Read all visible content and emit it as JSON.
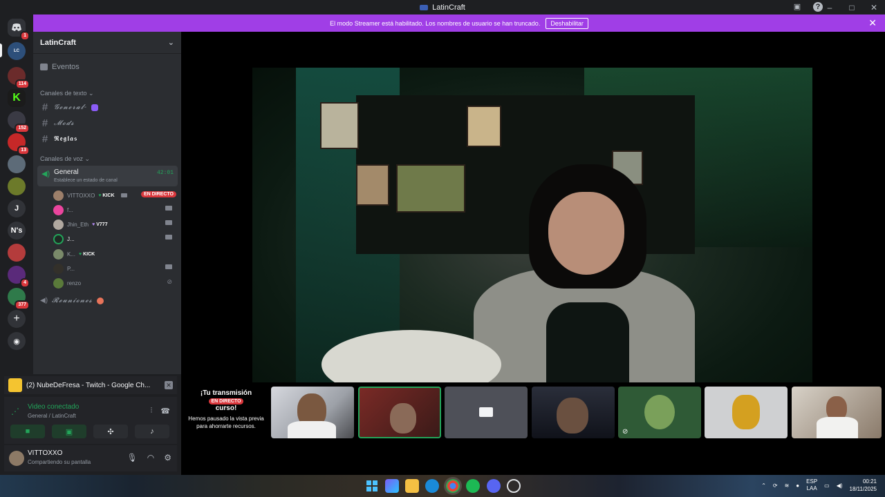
{
  "window": {
    "title": "LatinCraft"
  },
  "banner": {
    "message": "El modo Streamer está habilitado. Los nombres de usuario se han truncado.",
    "button": "Deshabilitar"
  },
  "rail": {
    "badges": [
      "1",
      "114",
      "152",
      "13",
      "4",
      "377"
    ],
    "letters": [
      "J",
      "N's"
    ]
  },
  "sidebar": {
    "guild_name": "LatinCraft",
    "events_label": "Eventos",
    "text_category": "Canales de texto",
    "text_channels": [
      "𝓖𝓮𝓷𝓮𝓻𝓪𝓵-",
      "𝓜𝓸𝓭𝓼",
      "𝕽𝖊𝖌𝖑𝖆𝖘"
    ],
    "voice_category": "Canales de voz",
    "voice_channel": {
      "name": "General",
      "status": "Establece un estado de canal",
      "timer": "42:01"
    },
    "voice_users": [
      {
        "name": "VITTOXXO",
        "tag": "KICK",
        "live": "EN DIRECTO"
      },
      {
        "name": "f..."
      },
      {
        "name": "Jhin_Eth",
        "tag": "V777"
      },
      {
        "name": "J..."
      },
      {
        "name": "K...",
        "tag": "KICK"
      },
      {
        "name": "P..."
      },
      {
        "name": "renzo"
      }
    ],
    "other_voice_channel": "𝓡𝓮𝓾𝓷𝓲𝓸𝓷𝓮𝓼"
  },
  "activity": {
    "title": "(2) NubeDeFresa - Twitch - Google Ch..."
  },
  "voice_panel": {
    "status": "Video conectado",
    "location": "General / LatinCraft"
  },
  "user_panel": {
    "username": "VITTOXXO",
    "status": "Compartiendo su pantalla"
  },
  "stream": {
    "live_card_title": "¡Tu transmisión",
    "live_card_title2": "curso!",
    "live_badge": "EN DIRECTO",
    "live_card_body": "Hemos pausado la vista previa para ahorrarte recursos."
  },
  "taskbar": {
    "lang": "ESP",
    "lang2": "LAA",
    "time": "00:21",
    "date": "18/11/2025"
  }
}
